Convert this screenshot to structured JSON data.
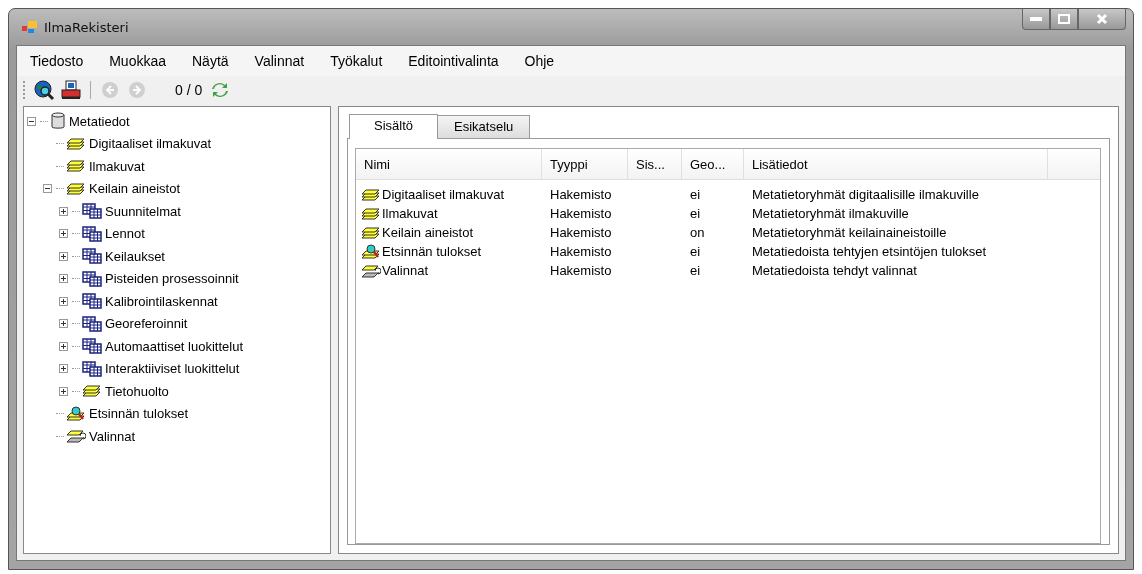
{
  "window": {
    "title": "IlmaRekisteri"
  },
  "menu": [
    "Tiedosto",
    "Muokkaa",
    "Näytä",
    "Valinnat",
    "Työkalut",
    "Editointivalinta",
    "Ohje"
  ],
  "toolbar": {
    "buttons": [
      {
        "kind": "globe",
        "disabled": false
      },
      {
        "kind": "printer",
        "disabled": false
      },
      {
        "kind": "back",
        "disabled": true
      },
      {
        "kind": "forward",
        "disabled": true
      }
    ],
    "counter": "0 / 0"
  },
  "tree": [
    {
      "label": "Metatiedot",
      "kind": "database",
      "expanded": true,
      "children": [
        {
          "label": "Digitaaliset ilmakuvat",
          "kind": "layers"
        },
        {
          "label": "Ilmakuvat",
          "kind": "layers"
        },
        {
          "label": "Keilain aineistot",
          "kind": "layers",
          "expanded": true,
          "children": [
            {
              "label": "Suunnitelmat",
              "kind": "table",
              "expanded": false
            },
            {
              "label": "Lennot",
              "kind": "table",
              "expanded": false
            },
            {
              "label": "Keilaukset",
              "kind": "table",
              "expanded": false
            },
            {
              "label": "Pisteiden prosessoinnit",
              "kind": "table",
              "expanded": false
            },
            {
              "label": "Kalibrointilaskennat",
              "kind": "table",
              "expanded": false
            },
            {
              "label": "Georeferoinnit",
              "kind": "table",
              "expanded": false
            },
            {
              "label": "Automaattiset luokittelut",
              "kind": "table",
              "expanded": false
            },
            {
              "label": "Interaktiiviset luokittelut",
              "kind": "table",
              "expanded": false
            },
            {
              "label": "Tietohuolto",
              "kind": "layers",
              "expanded": false
            }
          ]
        },
        {
          "label": "Etsinnän tulokset",
          "kind": "search"
        },
        {
          "label": "Valinnat",
          "kind": "selection"
        }
      ]
    }
  ],
  "tabs": [
    {
      "label": "Sisältö",
      "selected": true
    },
    {
      "label": "Esikatselu",
      "selected": false
    }
  ],
  "table": {
    "columns": [
      "Nimi",
      "Tyyppi",
      "Sis...",
      "Geo...",
      "Lisätiedot"
    ],
    "rows": [
      {
        "kind": "layers",
        "cells": [
          "Digitaaliset ilmakuvat",
          "Hakemisto",
          "",
          "ei",
          "Metatietoryhmät digitaalisille ilmakuville"
        ]
      },
      {
        "kind": "layers",
        "cells": [
          "Ilmakuvat",
          "Hakemisto",
          "",
          "ei",
          "Metatietoryhmät ilmakuville"
        ]
      },
      {
        "kind": "layers",
        "cells": [
          "Keilain aineistot",
          "Hakemisto",
          "",
          "on",
          "Metatietoryhmät keilainaineistoille"
        ]
      },
      {
        "kind": "search",
        "cells": [
          "Etsinnän tulokset",
          "Hakemisto",
          "",
          "ei",
          "Metatiedoista tehtyjen etsintöjen tulokset"
        ]
      },
      {
        "kind": "selection",
        "cells": [
          "Valinnat",
          "Hakemisto",
          "",
          "ei",
          "Metatiedoista tehdyt valinnat"
        ]
      }
    ]
  }
}
